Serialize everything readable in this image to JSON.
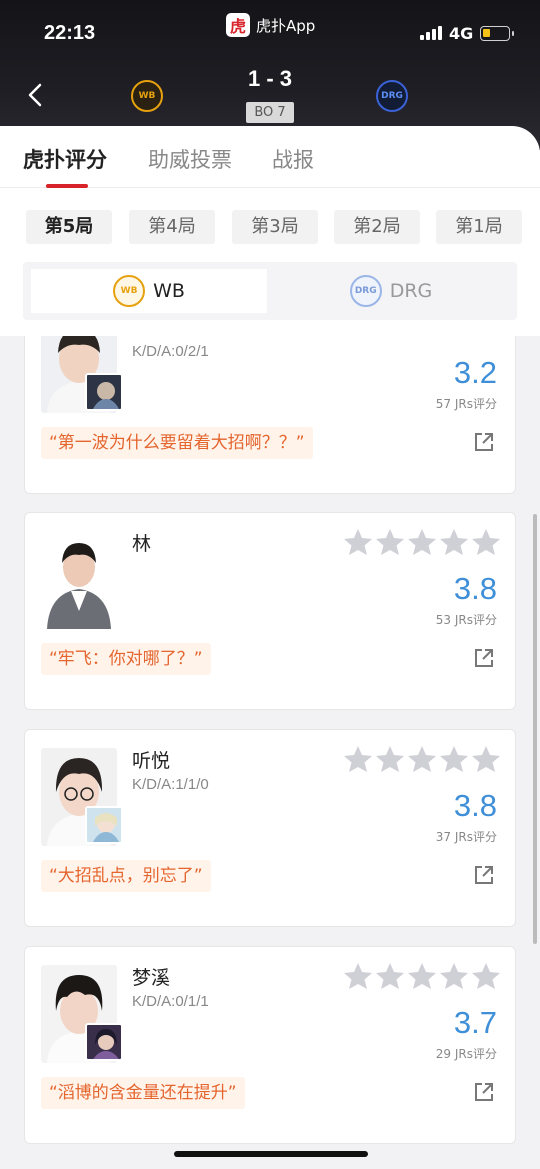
{
  "status_bar": {
    "time": "22:13",
    "app_name": "虎扑App",
    "network": "4G",
    "battery_level": 0.28
  },
  "match": {
    "score": "1 - 3",
    "format": "BO 7",
    "home_team": {
      "short": "WB",
      "color": "#e7a10f"
    },
    "away_team": {
      "short": "DRG",
      "color": "#3b62d6"
    }
  },
  "tabs": [
    {
      "label": "虎扑评分",
      "active": true
    },
    {
      "label": "助威投票",
      "active": false
    },
    {
      "label": "战报",
      "active": false
    }
  ],
  "games": [
    {
      "label": "第5局",
      "active": true
    },
    {
      "label": "第4局",
      "active": false
    },
    {
      "label": "第3局",
      "active": false
    },
    {
      "label": "第2局",
      "active": false
    },
    {
      "label": "第1局",
      "active": false
    }
  ],
  "team_switch": [
    {
      "label": "WB",
      "active": true
    },
    {
      "label": "DRG",
      "active": false
    }
  ],
  "players": [
    {
      "name": "",
      "kda": "K/D/A:0/2/1",
      "rating": "3.2",
      "votes": "57 JRs评分",
      "quote": "“第一波为什么要留着大招啊？？”"
    },
    {
      "name": "林",
      "kda": "",
      "rating": "3.8",
      "votes": "53 JRs评分",
      "quote": "“牢飞：你对哪了？”"
    },
    {
      "name": "听悦",
      "kda": "K/D/A:1/1/0",
      "rating": "3.8",
      "votes": "37 JRs评分",
      "quote": "“大招乱点，别忘了”"
    },
    {
      "name": "梦溪",
      "kda": "K/D/A:0/1/1",
      "rating": "3.7",
      "votes": "29 JRs评分",
      "quote": "“滔博的含金量还在提升”"
    }
  ],
  "icons": {
    "back": "chevron-left-icon",
    "share": "share-external-icon",
    "star": "star-icon"
  },
  "colors": {
    "accent_red": "#d8232a",
    "rating_blue": "#3e8fd8",
    "quote_orange": "#e4652e",
    "star_gray": "#cfcfd6"
  }
}
